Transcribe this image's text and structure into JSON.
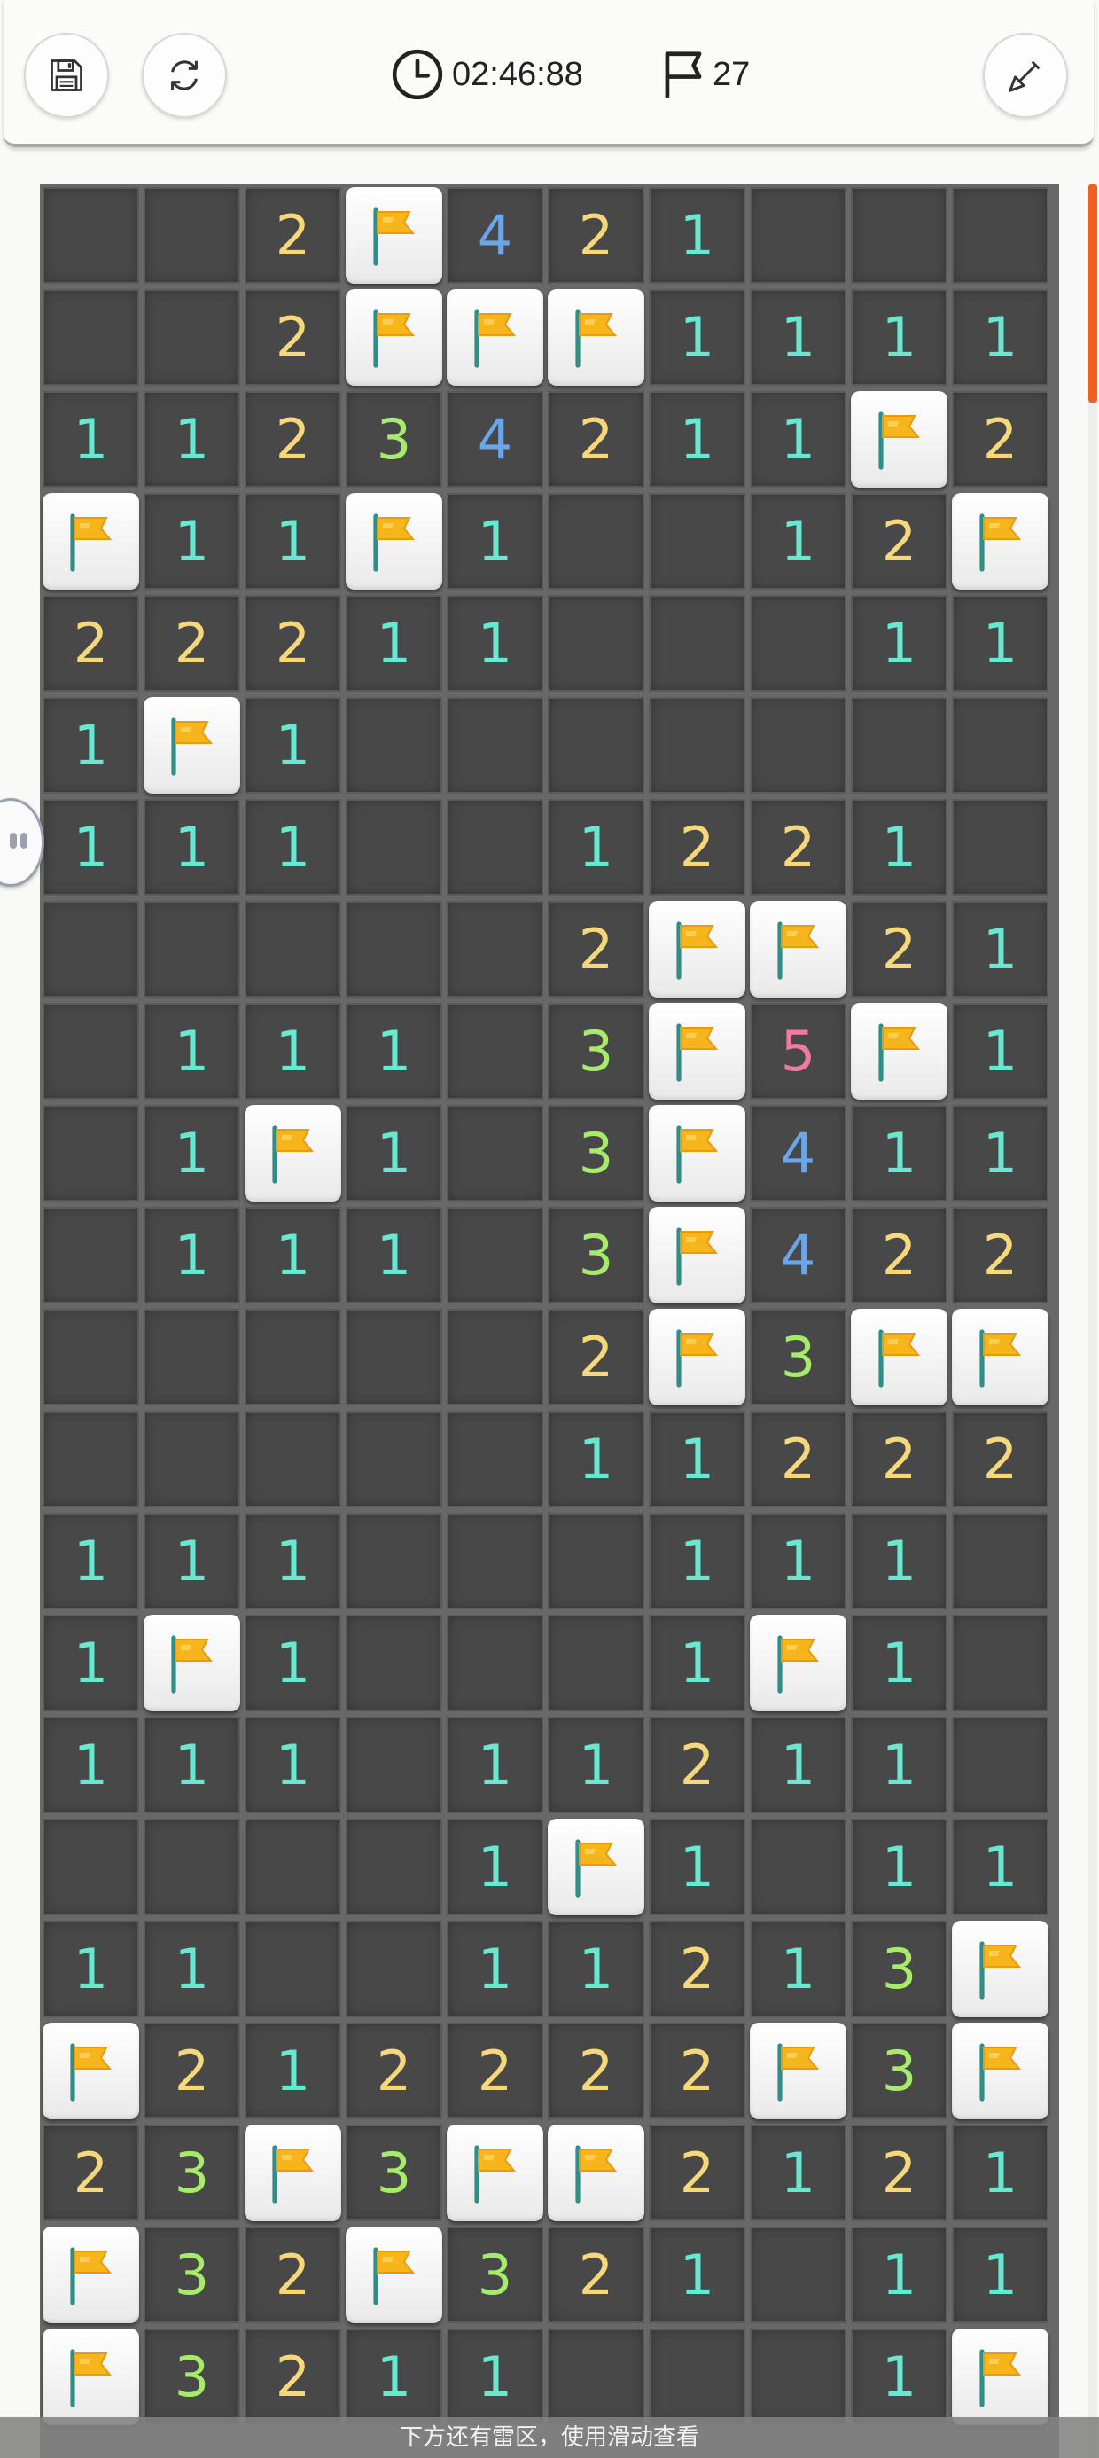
{
  "toolbar": {
    "save_icon": "floppy-disk-icon",
    "restart_icon": "refresh-icon",
    "timer_icon": "clock-icon",
    "timer": "02:46:88",
    "flags_icon": "flag-outline-icon",
    "flag_count": "27",
    "shovel_icon": "shovel-icon"
  },
  "colors": {
    "n1": "#67e8d0",
    "n2": "#f6d77a",
    "n3": "#a6ec6a",
    "n4": "#6aa6ea",
    "n5": "#f27a9f",
    "accent_scrollbar": "#f0601e"
  },
  "board": {
    "columns": 10,
    "legend": "F = flagged cell, 0 = empty revealed cell, number = adjacent mine count",
    "rows": [
      "0 0 2 F 4 2 1 0 0 0",
      "0 0 2 F F F 1 1 1 1",
      "1 1 2 3 4 2 1 1 F 2",
      "F 1 1 F 1 0 0 1 2 F",
      "2 2 2 1 1 0 0 0 1 1",
      "1 F 1 0 0 0 0 0 0 0",
      "1 1 1 0 0 1 2 2 1 0",
      "0 0 0 0 0 2 F F 2 1",
      "0 1 1 1 0 3 F 5 F 1",
      "0 1 F 1 0 3 F 4 1 1",
      "0 1 1 1 0 3 F 4 2 2",
      "0 0 0 0 0 2 F 3 F F",
      "0 0 0 0 0 1 1 2 2 2",
      "1 1 1 0 0 0 1 1 1 0",
      "1 F 1 0 0 0 1 F 1 0",
      "1 1 1 0 1 1 2 1 1 0",
      "0 0 0 0 1 F 1 0 1 1",
      "1 1 0 0 1 1 2 1 3 F",
      "F 2 1 2 2 2 2 F 3 F",
      "2 3 F 3 F F 2 1 2 1",
      "F 3 2 F 3 2 1 0 1 1",
      "F 3 2 1 1 0 0 0 1 F"
    ]
  },
  "hint": "下方还有雷区，使用滑动查看"
}
